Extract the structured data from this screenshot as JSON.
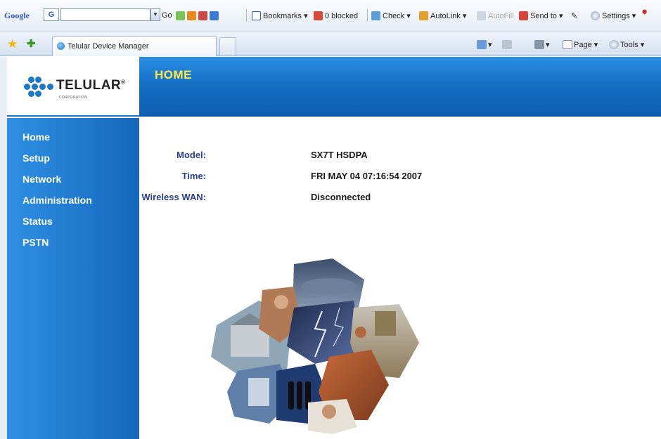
{
  "toolbar": {
    "google_logo": "Google",
    "google_button": "G",
    "go_label": "Go",
    "bookmarks_label": "Bookmarks",
    "popup_blocked_label": "0 blocked",
    "check_label": "Check",
    "autolink_label": "AutoLink",
    "autofill_label": "AutoFill",
    "send_to_label": "Send to",
    "settings_label": "Settings"
  },
  "browser": {
    "tab_title": "Telular Device Manager",
    "page_label": "Page",
    "tools_label": "Tools"
  },
  "brand": {
    "logo_text": "TELULAR",
    "logo_mark": "®",
    "logo_sub": "CORPORATION"
  },
  "header": {
    "title": "HOME"
  },
  "sidebar": {
    "items": [
      {
        "label": "Home"
      },
      {
        "label": "Setup"
      },
      {
        "label": "Network"
      },
      {
        "label": "Administration"
      },
      {
        "label": "Status"
      },
      {
        "label": "PSTN"
      }
    ]
  },
  "info": {
    "model_label": "Model:",
    "model_value": "SX7T HSDPA",
    "time_label": "Time:",
    "time_value": "FRI MAY 04 07:16:54 2007",
    "wan_label": "Wireless WAN:",
    "wan_value": "Disconnected"
  },
  "colors": {
    "accent_blue": "#1b73c8",
    "title_yellow": "#ffe94a",
    "label_blue": "#2b3f8f"
  }
}
